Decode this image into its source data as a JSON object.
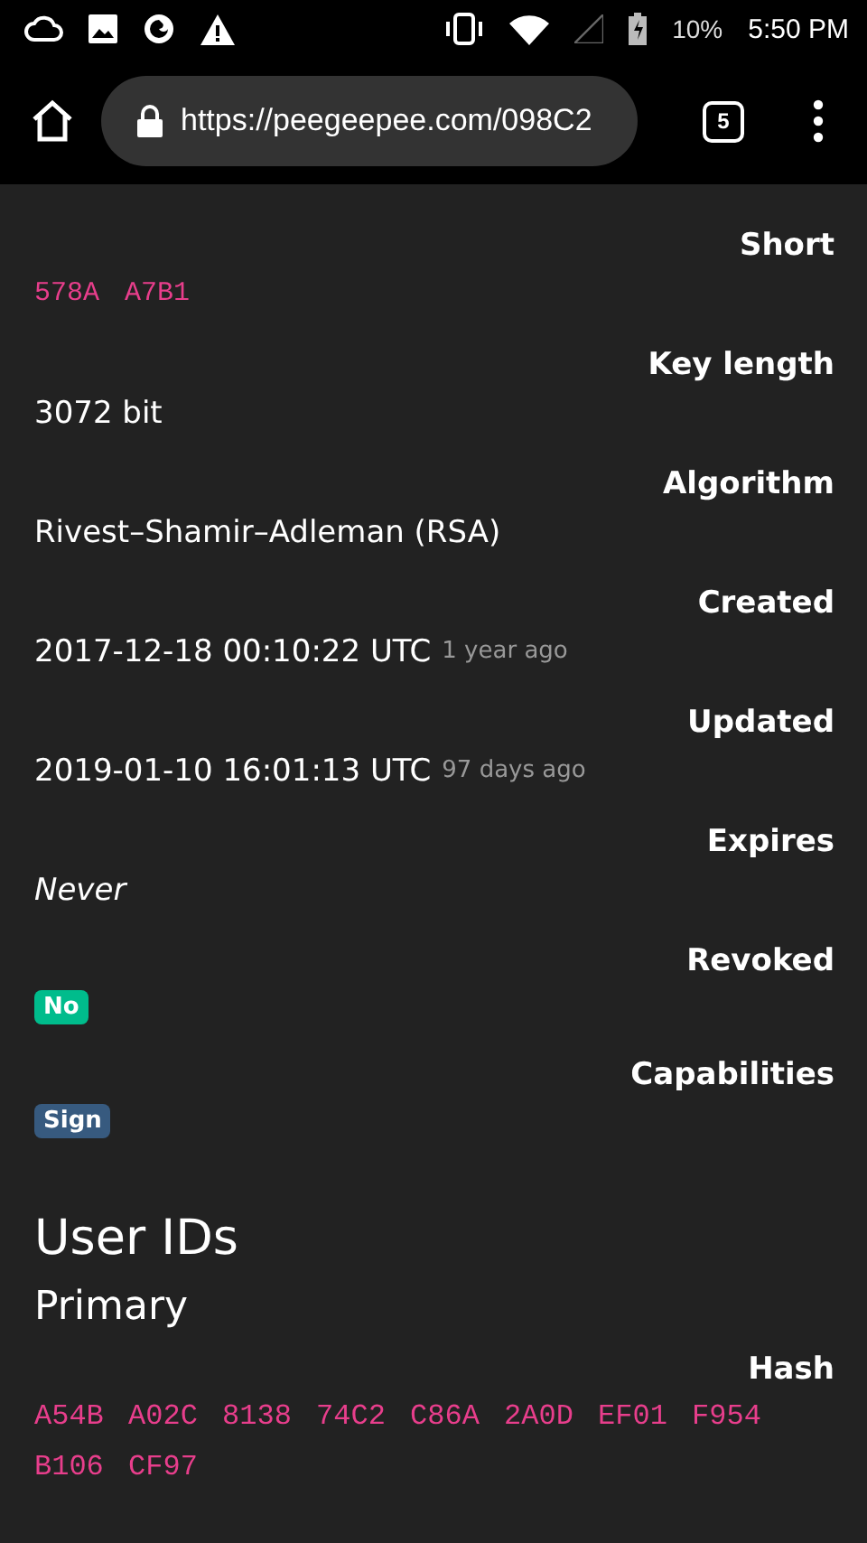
{
  "status_bar": {
    "battery": "10%",
    "time": "5:50 PM"
  },
  "browser": {
    "url": "https://peegeepee.com/098C2",
    "tab_count": "5"
  },
  "fields": [
    {
      "label": "Short",
      "kind": "mono",
      "value": "578A A7B1"
    },
    {
      "label": "Key length",
      "kind": "text",
      "value": "3072 bit"
    },
    {
      "label": "Algorithm",
      "kind": "text",
      "value": "Rivest–Shamir–Adleman (RSA)"
    },
    {
      "label": "Created",
      "kind": "date",
      "value": "2017-12-18 00:10:22 UTC",
      "note": "1 year ago"
    },
    {
      "label": "Updated",
      "kind": "date",
      "value": "2019-01-10 16:01:13 UTC",
      "note": "97 days ago"
    },
    {
      "label": "Expires",
      "kind": "italic",
      "value": "Never"
    },
    {
      "label": "Revoked",
      "kind": "badge",
      "value": "No",
      "color": "#00bc8c"
    },
    {
      "label": "Capabilities",
      "kind": "badge",
      "value": "Sign",
      "color": "#375a7f"
    }
  ],
  "user_ids": {
    "heading": "User IDs",
    "subheading": "Primary",
    "hash_label": "Hash",
    "hash": "A54B A02C 8138 74C2 C86A 2A0D EF01 F954 B106 CF97"
  }
}
